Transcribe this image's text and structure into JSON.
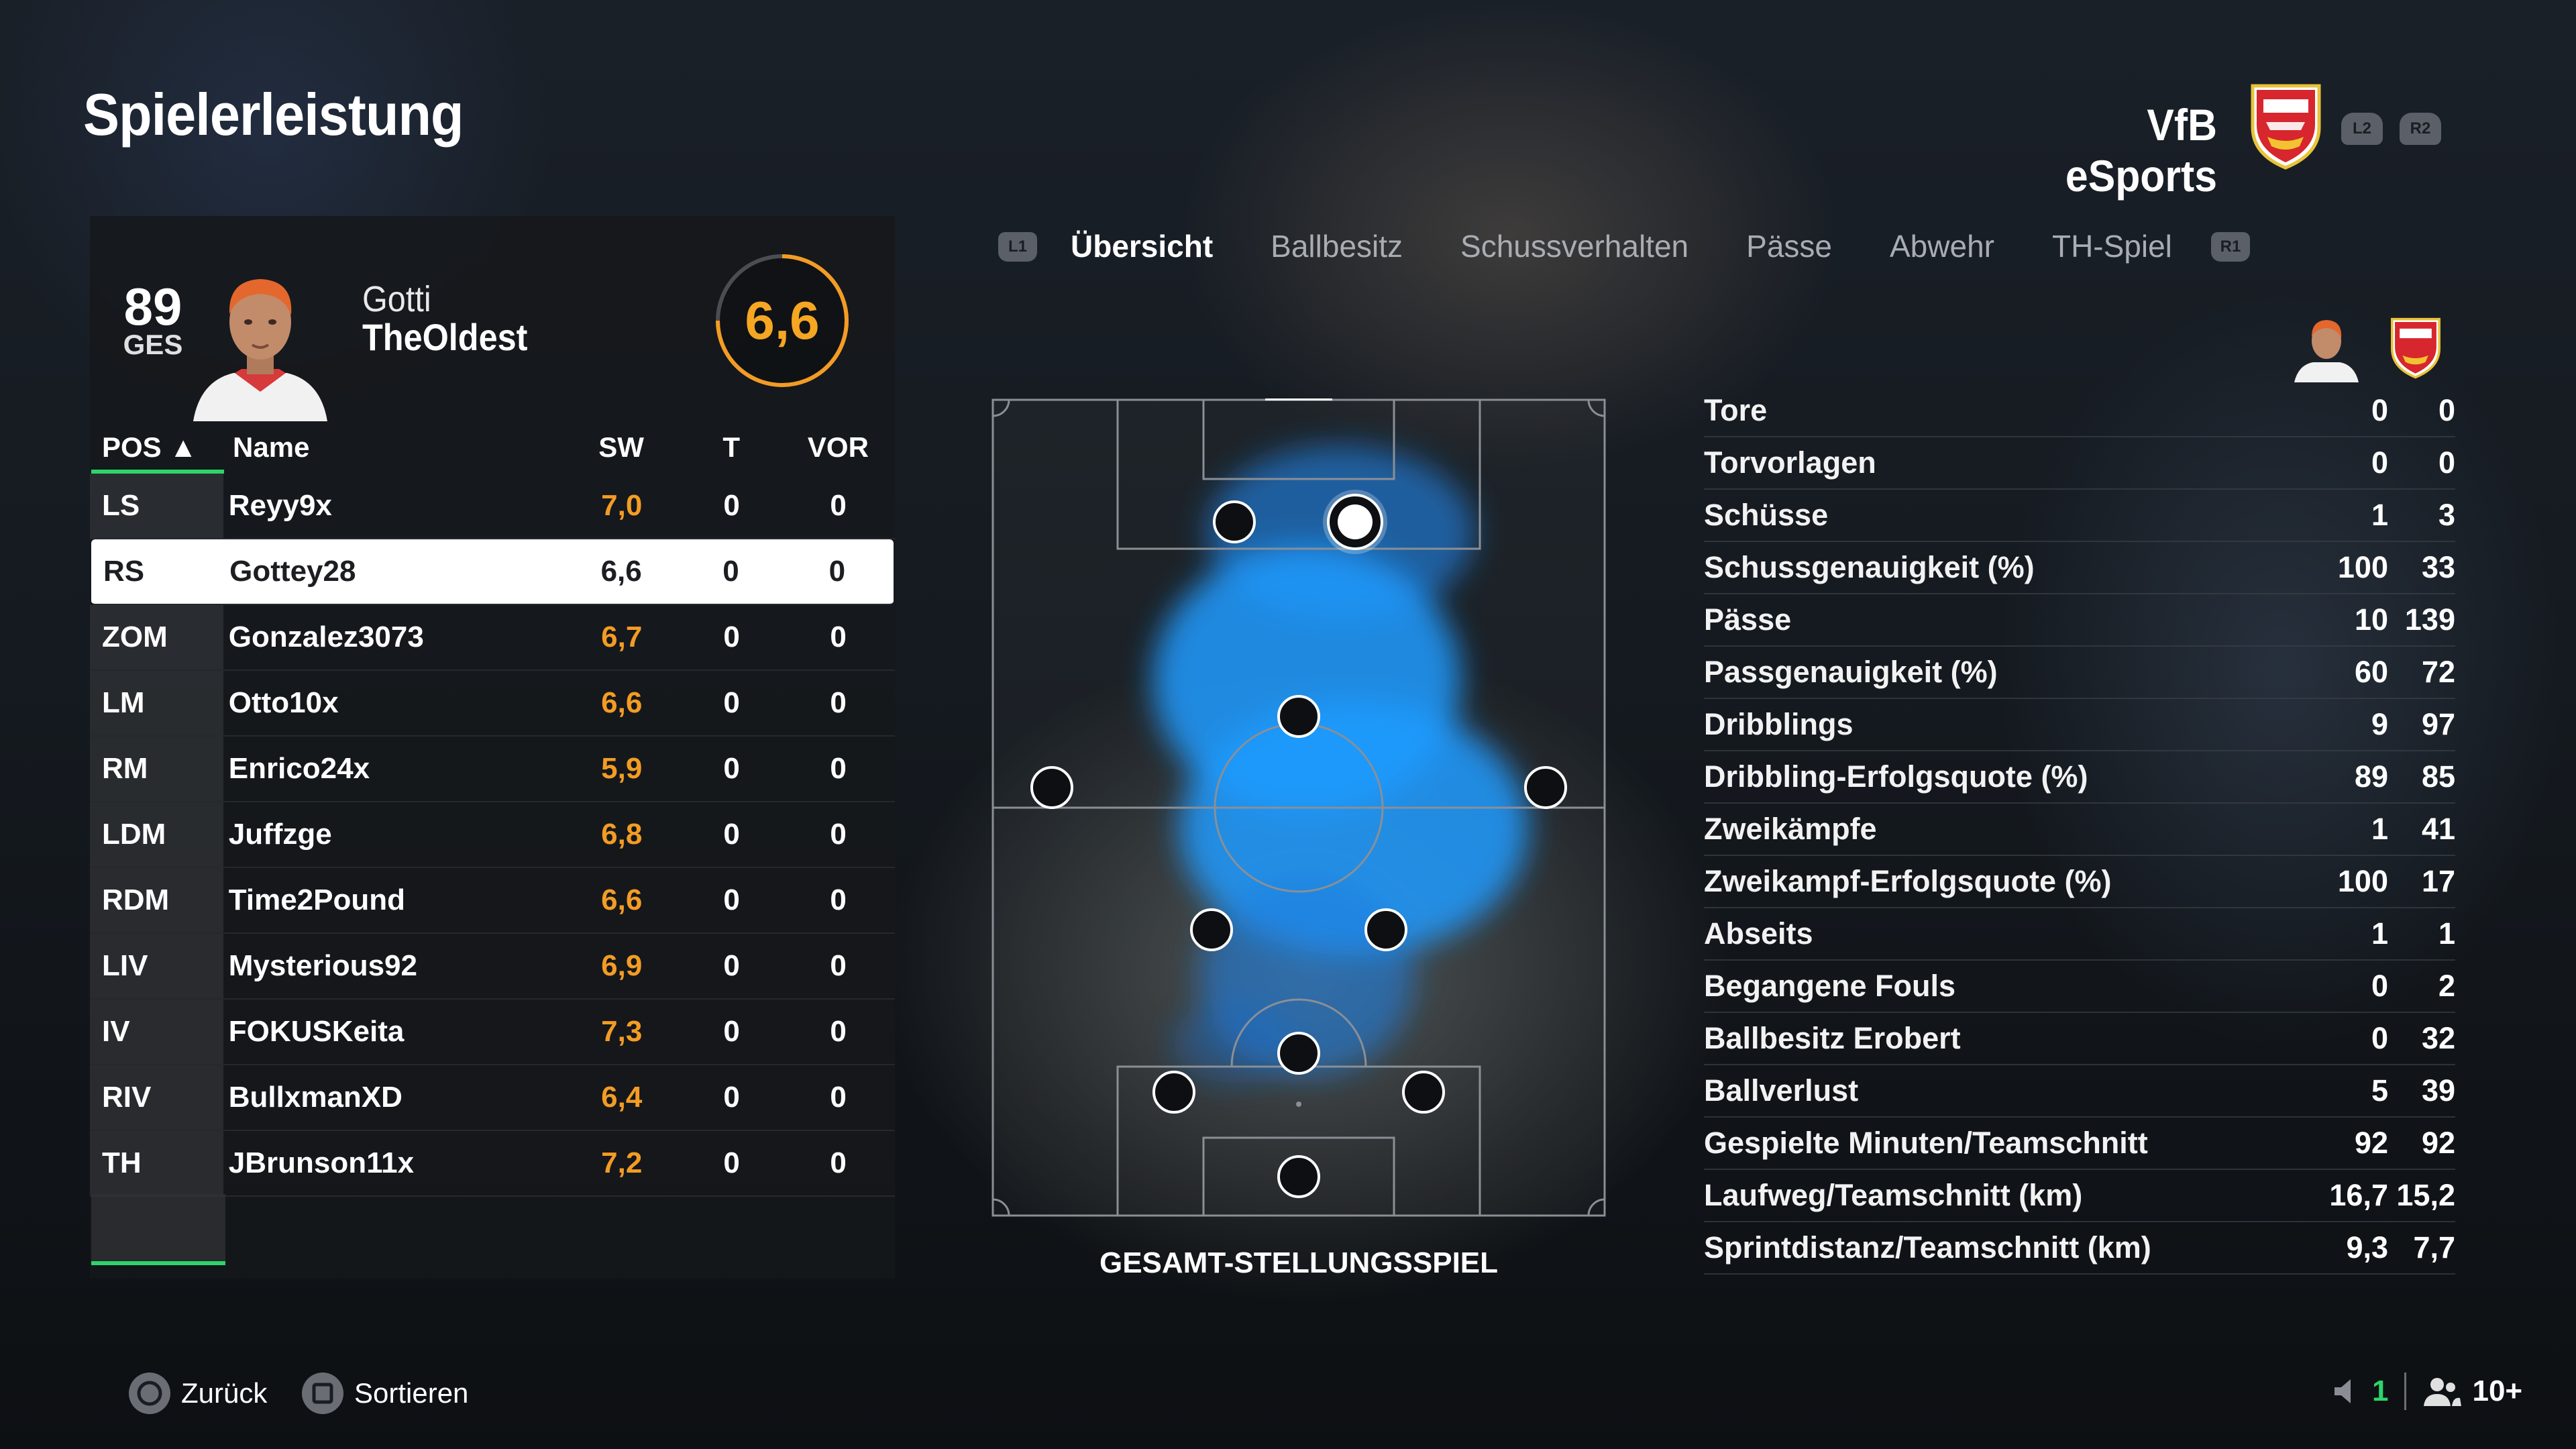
{
  "header": {
    "title": "Spielerleistung",
    "team_name": "VfB eSports",
    "trigger_left": "L2",
    "trigger_right": "R2"
  },
  "player": {
    "overall": "89",
    "overall_label": "GES",
    "first_name": "Gotti",
    "last_name": "TheOldest",
    "match_rating": "6,6"
  },
  "table": {
    "headers": {
      "pos": "POS ▲",
      "name": "Name",
      "sw": "SW",
      "t": "T",
      "vor": "VOR"
    },
    "rows": [
      {
        "pos": "LS",
        "name": "Reyy9x",
        "sw": "7,0",
        "t": "0",
        "vor": "0"
      },
      {
        "pos": "RS",
        "name": "Gottey28",
        "sw": "6,6",
        "t": "0",
        "vor": "0"
      },
      {
        "pos": "ZOM",
        "name": "Gonzalez3073",
        "sw": "6,7",
        "t": "0",
        "vor": "0"
      },
      {
        "pos": "LM",
        "name": "Otto10x",
        "sw": "6,6",
        "t": "0",
        "vor": "0"
      },
      {
        "pos": "RM",
        "name": "Enrico24x",
        "sw": "5,9",
        "t": "0",
        "vor": "0"
      },
      {
        "pos": "LDM",
        "name": "Juffzge",
        "sw": "6,8",
        "t": "0",
        "vor": "0"
      },
      {
        "pos": "RDM",
        "name": "Time2Pound",
        "sw": "6,6",
        "t": "0",
        "vor": "0"
      },
      {
        "pos": "LIV",
        "name": "Mysterious92",
        "sw": "6,9",
        "t": "0",
        "vor": "0"
      },
      {
        "pos": "IV",
        "name": "FOKUSKeita",
        "sw": "7,3",
        "t": "0",
        "vor": "0"
      },
      {
        "pos": "RIV",
        "name": "BullxmanXD",
        "sw": "6,4",
        "t": "0",
        "vor": "0"
      },
      {
        "pos": "TH",
        "name": "JBrunson11x",
        "sw": "7,2",
        "t": "0",
        "vor": "0"
      }
    ]
  },
  "tabs": {
    "left_button": "L1",
    "right_button": "R1",
    "items": [
      "Übersicht",
      "Ballbesitz",
      "Schussverhalten",
      "Pässe",
      "Abwehr",
      "TH-Spiel"
    ]
  },
  "pitch": {
    "caption": "GESAMT-STELLUNGSSPIEL"
  },
  "stats": [
    {
      "label": "Tore",
      "player": "0",
      "team": "0"
    },
    {
      "label": "Torvorlagen",
      "player": "0",
      "team": "0"
    },
    {
      "label": "Schüsse",
      "player": "1",
      "team": "3"
    },
    {
      "label": "Schussgenauigkeit (%)",
      "player": "100",
      "team": "33"
    },
    {
      "label": "Pässe",
      "player": "10",
      "team": "139"
    },
    {
      "label": "Passgenauigkeit (%)",
      "player": "60",
      "team": "72"
    },
    {
      "label": "Dribblings",
      "player": "9",
      "team": "97"
    },
    {
      "label": "Dribbling-Erfolgsquote (%)",
      "player": "89",
      "team": "85"
    },
    {
      "label": "Zweikämpfe",
      "player": "1",
      "team": "41"
    },
    {
      "label": "Zweikampf-Erfolgsquote (%)",
      "player": "100",
      "team": "17"
    },
    {
      "label": "Abseits",
      "player": "1",
      "team": "1"
    },
    {
      "label": "Begangene Fouls",
      "player": "0",
      "team": "2"
    },
    {
      "label": "Ballbesitz Erobert",
      "player": "0",
      "team": "32"
    },
    {
      "label": "Ballverlust",
      "player": "5",
      "team": "39"
    },
    {
      "label": "Gespielte Minuten/Teamschnitt",
      "player": "92",
      "team": "92"
    },
    {
      "label": "Laufweg/Teamschnitt (km)",
      "player": "16,7",
      "team": "15,2"
    },
    {
      "label": "Sprintdistanz/Teamschnitt (km)",
      "player": "9,3",
      "team": "7,7"
    }
  ],
  "footer": {
    "back_label": "Zurück",
    "sort_label": "Sortieren",
    "voice_count": "1",
    "party_count": "10+"
  },
  "colors": {
    "accent_green": "#2ed46a",
    "rating_orange": "#f39c24",
    "heatmap_blue": "#1e9bff"
  }
}
